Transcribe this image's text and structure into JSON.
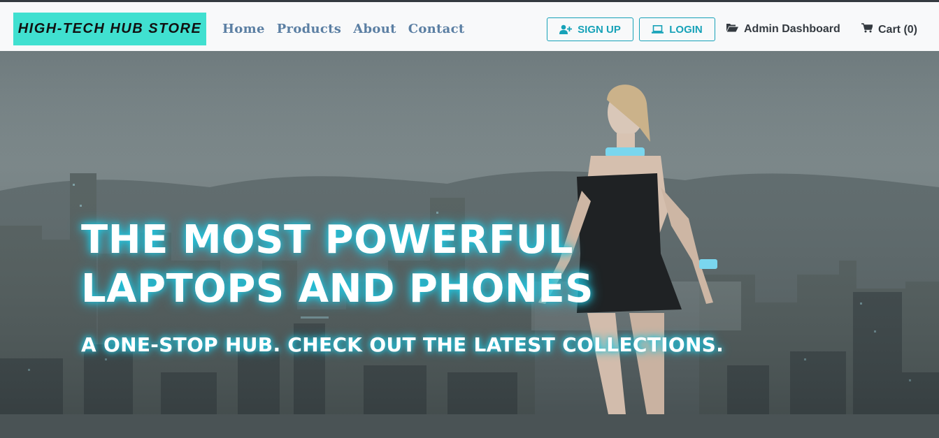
{
  "brand": {
    "name": "HIGH-TECH HUB STORE",
    "color": "#40e0d0"
  },
  "nav": {
    "links": [
      {
        "label": "Home"
      },
      {
        "label": "Products"
      },
      {
        "label": "About"
      },
      {
        "label": "Contact"
      }
    ],
    "signup": {
      "label": "SIGN UP",
      "icon": "user-plus-icon"
    },
    "login": {
      "label": "LOGIN",
      "icon": "laptop-icon"
    },
    "admin": {
      "label": "Admin Dashboard",
      "icon": "folder-open-icon"
    },
    "cart": {
      "label": "Cart (0)",
      "icon": "cart-icon"
    },
    "accent_color": "#17a2b8"
  },
  "hero": {
    "title": "THE MOST POWERFUL LAPTOPS AND PHONES",
    "subtitle": "A ONE-STOP HUB. CHECK OUT THE LATEST COLLECTIONS.",
    "glow_color": "#20c6e0"
  }
}
